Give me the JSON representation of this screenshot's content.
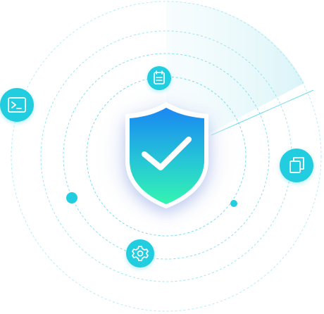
{
  "illustration": {
    "status": "protected",
    "center_badge": "shield-check-icon",
    "orbit_icons": [
      "clipboard-icon",
      "terminal-icon",
      "copy-icon",
      "gear-icon"
    ],
    "colors": {
      "accent_teal": "#22cde0",
      "shield_top": "#1d8ef0",
      "shield_bottom": "#2ff2b4",
      "ring_line": "#4fd3e6",
      "radar_sweep": "#d4f4f8"
    }
  }
}
